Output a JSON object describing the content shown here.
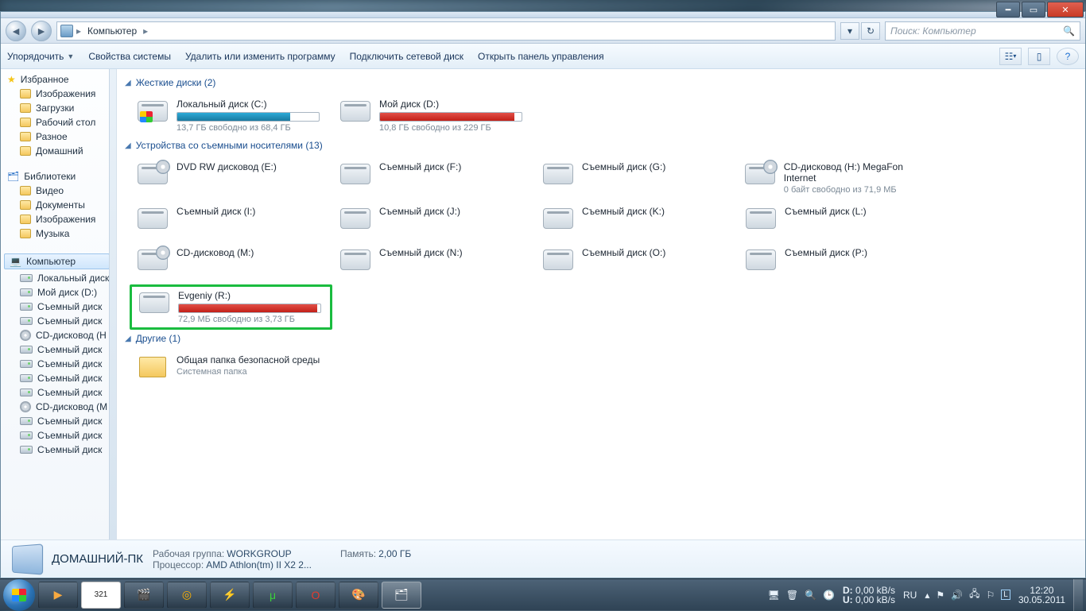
{
  "breadcrumb": {
    "root": "Компьютер"
  },
  "search": {
    "placeholder": "Поиск: Компьютер"
  },
  "toolbar": {
    "organize": "Упорядочить",
    "props": "Свойства системы",
    "uninstall": "Удалить или изменить программу",
    "map": "Подключить сетевой диск",
    "cpanel": "Открыть панель управления"
  },
  "sidebar": {
    "favorites": {
      "title": "Избранное",
      "items": [
        "Изображения",
        "Загрузки",
        "Рабочий стол",
        "Разное",
        "Домашний"
      ]
    },
    "libraries": {
      "title": "Библиотеки",
      "items": [
        "Видео",
        "Документы",
        "Изображения",
        "Музыка"
      ]
    },
    "computer": {
      "title": "Компьютер",
      "items": [
        "Локальный диск",
        "Мой диск (D:)",
        "Съемный диск",
        "Съемный диск",
        "CD-дисковод (H",
        "Съемный диск",
        "Съемный диск",
        "Съемный диск",
        "Съемный диск",
        "CD-дисковод (M",
        "Съемный диск",
        "Съемный диск",
        "Съемный диск"
      ]
    }
  },
  "groups": {
    "hdd": {
      "title": "Жесткие диски (2)",
      "items": [
        {
          "name": "Локальный диск (C:)",
          "bar": true,
          "fill_pct": 80,
          "ok": true,
          "sub": "13,7 ГБ свободно из 68,4 ГБ",
          "icon": "win"
        },
        {
          "name": "Мой диск (D:)",
          "bar": true,
          "fill_pct": 95,
          "ok": false,
          "sub": "10,8 ГБ свободно из 229 ГБ",
          "icon": "plain"
        }
      ]
    },
    "removable": {
      "title": "Устройства со съемными носителями (13)",
      "rows": [
        [
          {
            "name": "DVD RW дисковод (E:)",
            "sub": "",
            "icon": "disc"
          },
          {
            "name": "Съемный диск (F:)",
            "sub": "",
            "icon": "plain"
          },
          {
            "name": "Съемный диск (G:)",
            "sub": "",
            "icon": "plain"
          },
          {
            "name": "CD-дисковод (H:) MegaFon Internet",
            "sub": "0 байт свободно из 71,9 МБ",
            "icon": "disc"
          }
        ],
        [
          {
            "name": "Съемный диск (I:)",
            "sub": "",
            "icon": "plain"
          },
          {
            "name": "Съемный диск (J:)",
            "sub": "",
            "icon": "plain"
          },
          {
            "name": "Съемный диск (K:)",
            "sub": "",
            "icon": "plain"
          },
          {
            "name": "Съемный диск (L:)",
            "sub": "",
            "icon": "plain"
          }
        ],
        [
          {
            "name": "CD-дисковод (M:)",
            "sub": "",
            "icon": "disc"
          },
          {
            "name": "Съемный диск (N:)",
            "sub": "",
            "icon": "plain"
          },
          {
            "name": "Съемный диск (O:)",
            "sub": "",
            "icon": "plain"
          },
          {
            "name": "Съемный диск (P:)",
            "sub": "",
            "icon": "plain"
          }
        ],
        [
          {
            "name": "Evgeniy (R:)",
            "sub": "72,9 МБ свободно из 3,73 ГБ",
            "icon": "plain",
            "bar": true,
            "fill_pct": 98,
            "ok": false,
            "highlight": true
          }
        ]
      ]
    },
    "other": {
      "title": "Другие (1)",
      "items": [
        {
          "name": "Общая папка безопасной среды",
          "sub": "Системная папка",
          "icon": "folder"
        }
      ]
    }
  },
  "details": {
    "title": "ДОМАШНИЙ-ПК",
    "workgroup_label": "Рабочая группа:",
    "workgroup_value": "WORKGROUP",
    "cpu_label": "Процессор:",
    "cpu_value": "AMD Athlon(tm) II X2 2...",
    "mem_label": "Память:",
    "mem_value": "2,00 ГБ"
  },
  "tray": {
    "net": {
      "d_label": "D:",
      "d_val": "0,00 kB/s",
      "u_label": "U:",
      "u_val": "0,00 kB/s"
    },
    "lang": "RU",
    "clock": {
      "time": "12:20",
      "date": "30.05.2011"
    }
  }
}
